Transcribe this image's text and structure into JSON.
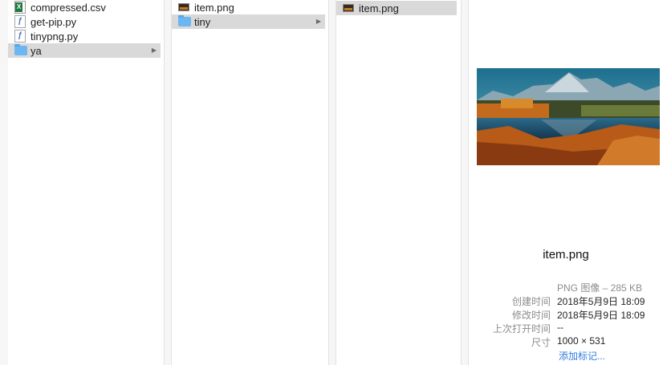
{
  "columns": [
    {
      "items": [
        {
          "label": "compressed.csv",
          "icon": "excel-file-icon",
          "selected": false,
          "folder": false
        },
        {
          "label": "get-pip.py",
          "icon": "python-file-icon",
          "selected": false,
          "folder": false
        },
        {
          "label": "tinypng.py",
          "icon": "python-file-icon",
          "selected": false,
          "folder": false
        },
        {
          "label": "ya",
          "icon": "folder-icon",
          "selected": true,
          "folder": true
        }
      ]
    },
    {
      "items": [
        {
          "label": "item.png",
          "icon": "image-file-icon",
          "selected": false,
          "folder": false
        },
        {
          "label": "tiny",
          "icon": "folder-icon",
          "selected": true,
          "folder": true
        }
      ]
    },
    {
      "items": [
        {
          "label": "item.png",
          "icon": "image-file-icon",
          "selected": true,
          "folder": false
        }
      ]
    }
  ],
  "preview": {
    "file_name": "item.png",
    "kind": "PNG 图像 – 285 KB",
    "created_label": "创建时间",
    "created_value": "2018年5月9日 18:09",
    "modified_label": "修改时间",
    "modified_value": "2018年5月9日 18:09",
    "opened_label": "上次打开时间",
    "opened_value": "--",
    "size_label": "尺寸",
    "size_value": "1000 × 531",
    "add_tags": "添加标记..."
  },
  "colors": {
    "selection": "#d9d9d9",
    "folder": "#6cb6f2",
    "link": "#2f7de1"
  }
}
